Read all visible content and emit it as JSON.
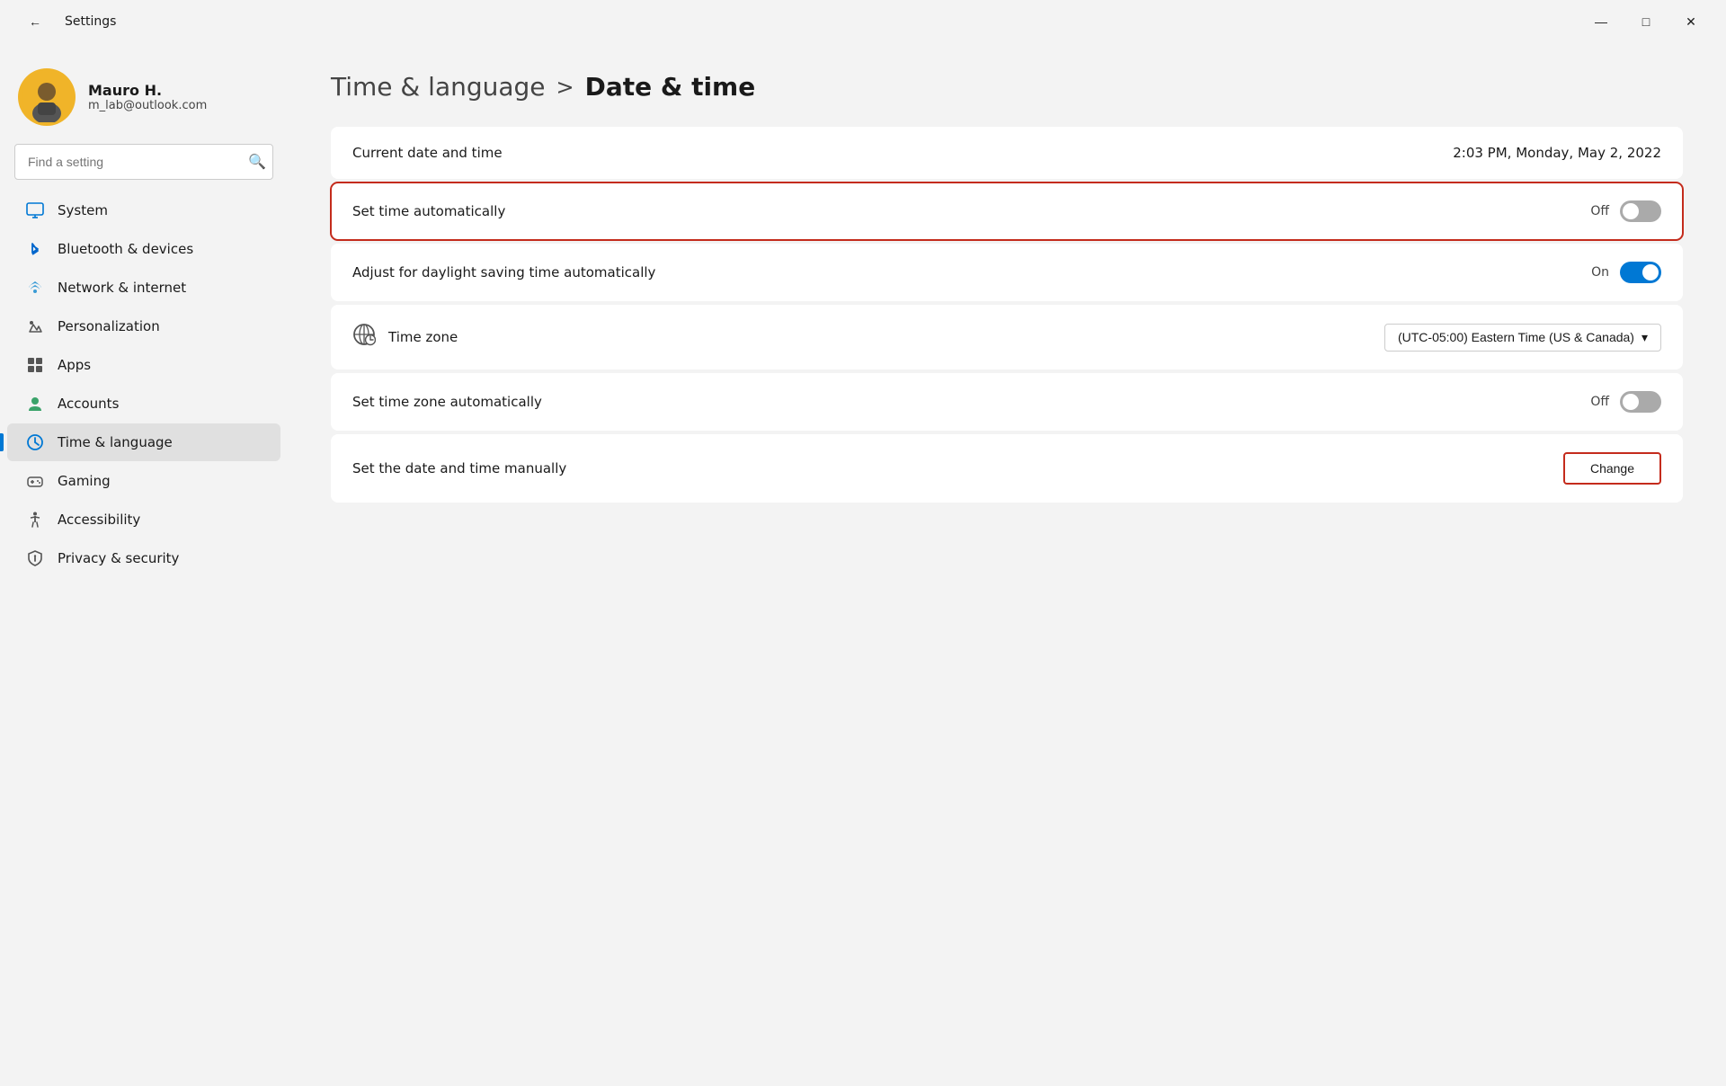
{
  "titlebar": {
    "back_icon": "←",
    "title": "Settings",
    "minimize_icon": "—",
    "maximize_icon": "□",
    "close_icon": "✕"
  },
  "sidebar": {
    "user": {
      "name": "Mauro H.",
      "email": "m_lab@outlook.com"
    },
    "search": {
      "placeholder": "Find a setting",
      "icon": "🔍"
    },
    "nav_items": [
      {
        "id": "system",
        "label": "System",
        "icon_color": "#0078d4",
        "icon": "💻"
      },
      {
        "id": "bluetooth",
        "label": "Bluetooth & devices",
        "icon_color": "#0078d4",
        "icon": "🔵"
      },
      {
        "id": "network",
        "label": "Network & internet",
        "icon_color": "#3a9bd5",
        "icon": "🌐"
      },
      {
        "id": "personalization",
        "label": "Personalization",
        "icon_color": "#555",
        "icon": "✏️"
      },
      {
        "id": "apps",
        "label": "Apps",
        "icon_color": "#555",
        "icon": "🖥️"
      },
      {
        "id": "accounts",
        "label": "Accounts",
        "icon_color": "#3aa36a",
        "icon": "👤"
      },
      {
        "id": "time",
        "label": "Time & language",
        "icon_color": "#0078d4",
        "icon": "🕐",
        "active": true
      },
      {
        "id": "gaming",
        "label": "Gaming",
        "icon_color": "#555",
        "icon": "🎮"
      },
      {
        "id": "accessibility",
        "label": "Accessibility",
        "icon_color": "#555",
        "icon": "♿"
      },
      {
        "id": "privacy",
        "label": "Privacy & security",
        "icon_color": "#555",
        "icon": "🛡️"
      }
    ]
  },
  "content": {
    "breadcrumb_parent": "Time & language",
    "breadcrumb_separator": ">",
    "breadcrumb_current": "Date & time",
    "settings": {
      "current_date_time": {
        "label": "Current date and time",
        "value": "2:03 PM, Monday, May 2, 2022"
      },
      "set_time_auto": {
        "label": "Set time automatically",
        "toggle_label": "Off",
        "state": "off",
        "highlighted": true
      },
      "daylight_saving": {
        "label": "Adjust for daylight saving time automatically",
        "toggle_label": "On",
        "state": "on",
        "highlighted": false
      },
      "timezone": {
        "label": "Time zone",
        "value": "(UTC-05:00) Eastern Time (US & Canada)",
        "icon": "🌐"
      },
      "set_zone_auto": {
        "label": "Set time zone automatically",
        "toggle_label": "Off",
        "state": "off",
        "highlighted": false
      },
      "manual": {
        "label": "Set the date and time manually",
        "button_label": "Change",
        "highlighted": true
      }
    }
  }
}
